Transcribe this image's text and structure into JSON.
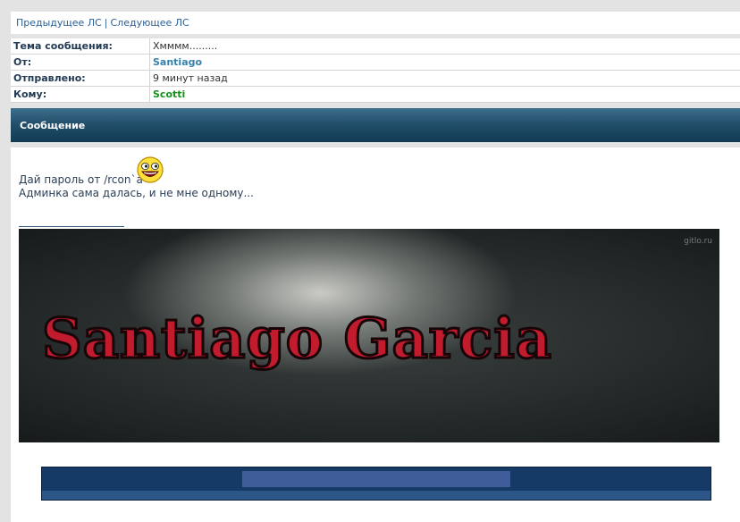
{
  "nav": {
    "prev_label": "Предыдущее ЛС",
    "separator": "|",
    "next_label": "Следующее ЛС"
  },
  "info": {
    "subject_label": "Тема сообщения:",
    "subject_value": "Хмммм.........",
    "from_label": "От:",
    "from_value": "Santiago",
    "sent_label": "Отправлено:",
    "sent_value": "9 минут назад",
    "to_label": "Кому:",
    "to_value": "Scotti"
  },
  "message": {
    "header": "Сообщение",
    "line1": "Дай пароль от /rcon`a",
    "line2": "Админка сама далась, и не мне одному...",
    "smiley_icon": "awesome-smiley-icon",
    "banner_text": "Santiago Garcia",
    "banner_watermark": "gitlo.ru"
  },
  "colors": {
    "link": "#2d6095",
    "from": "#3681ad",
    "to": "#16901d",
    "header_bg": "#23506c"
  }
}
